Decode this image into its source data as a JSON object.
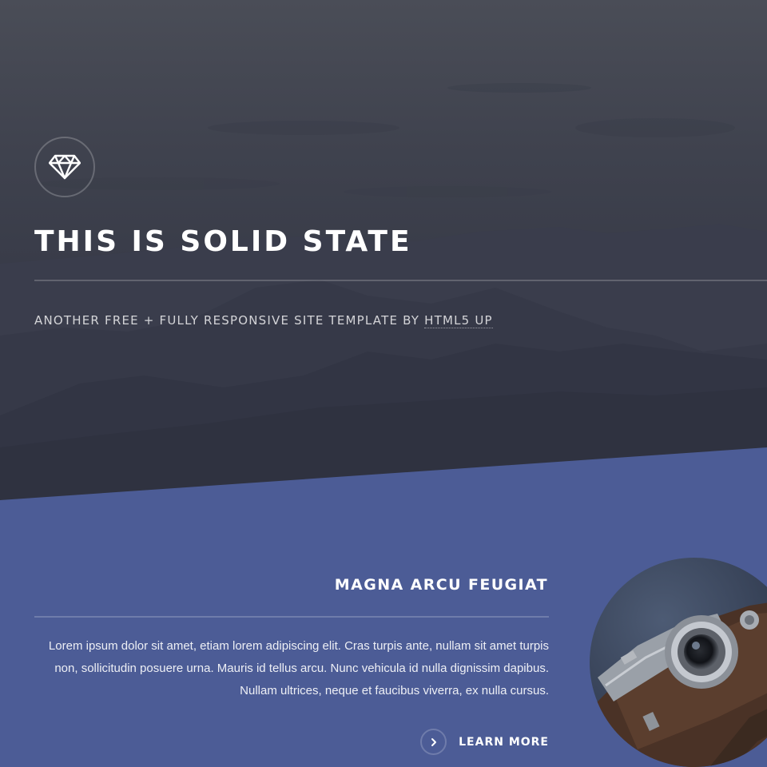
{
  "banner": {
    "logo_icon": "diamond-icon",
    "title": "THIS IS SOLID STATE",
    "tagline_prefix": "ANOTHER FREE + FULLY RESPONSIVE SITE TEMPLATE BY ",
    "tagline_link": "HTML5 UP"
  },
  "section": {
    "title": "MAGNA ARCU FEUGIAT",
    "text": "Lorem ipsum dolor sit amet, etiam lorem adipiscing elit. Cras turpis ante, nullam sit amet turpis non, sollicitudin posuere urna. Mauris id tellus arcu. Nunc vehicula id nulla dignissim dapibus. Nullam ultrices, neque et faucibus viverra, ex nulla cursus.",
    "learn_more_label": "LEARN MORE",
    "learn_more_icon": "chevron-right-icon",
    "image": "camera-photo"
  },
  "colors": {
    "banner_overlay": "#2e3141",
    "section_bg": "#4c5c96",
    "text": "#ffffff"
  }
}
